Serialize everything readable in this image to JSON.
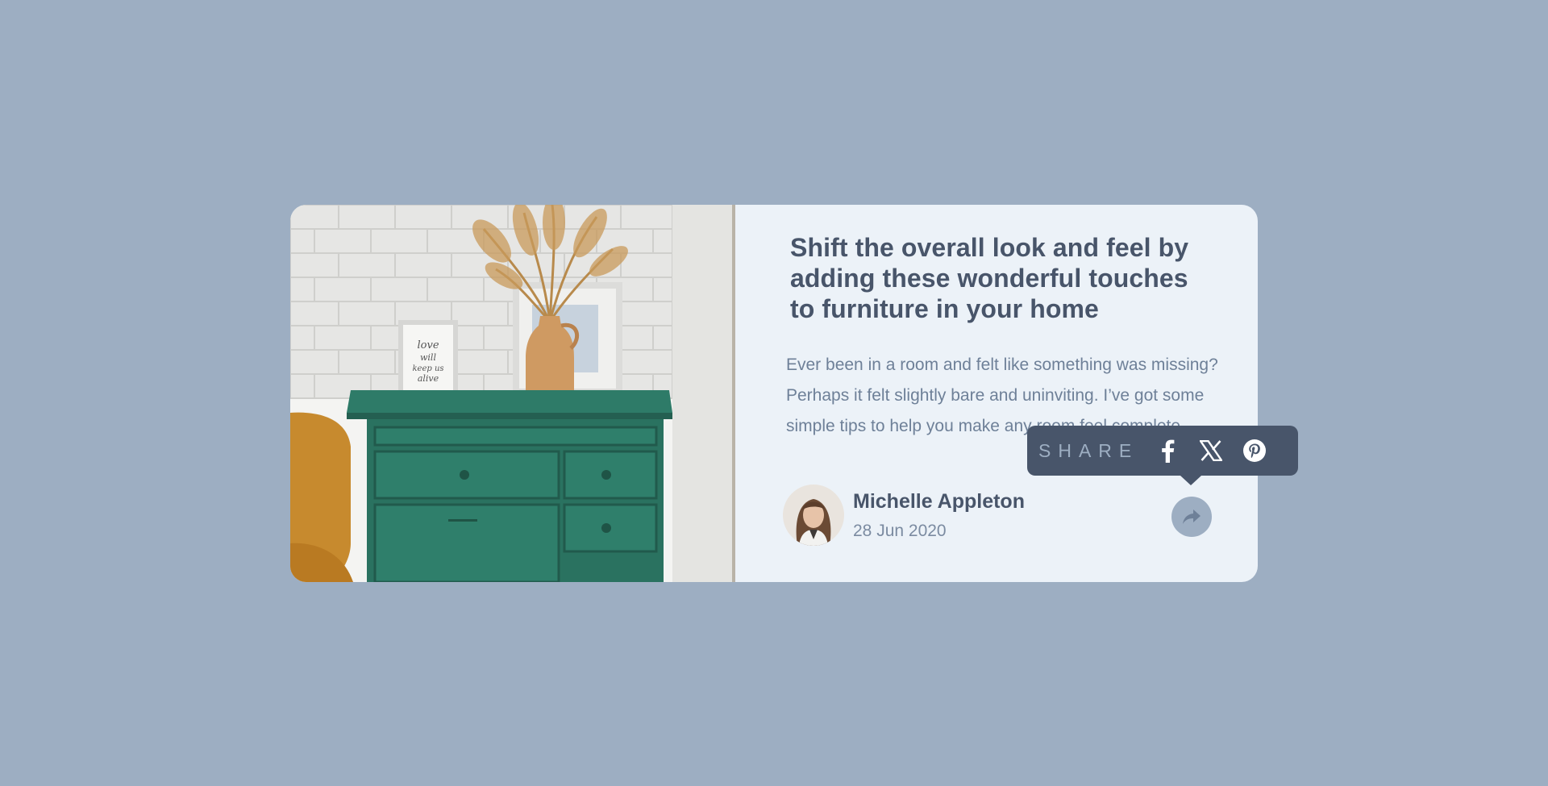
{
  "article": {
    "title": "Shift the overall look and feel by adding these wonderful touches to furniture in your home",
    "excerpt": "Ever been in a room and felt like something was missing? Perhaps it felt slightly bare and uninviting. I’ve got some simple tips to help you make any room feel complete.",
    "image_icon": "drawers-photo"
  },
  "author": {
    "name": "Michelle Appleton",
    "date": "28 Jun 2020"
  },
  "share": {
    "label": "SHARE",
    "networks": [
      "facebook-icon",
      "x-icon",
      "pinterest-icon"
    ]
  },
  "colors": {
    "background": "#9daec2",
    "card": "#ecf2f8",
    "heading": "#48556a",
    "body_text": "#6e8098",
    "tooltip": "#48556a"
  }
}
